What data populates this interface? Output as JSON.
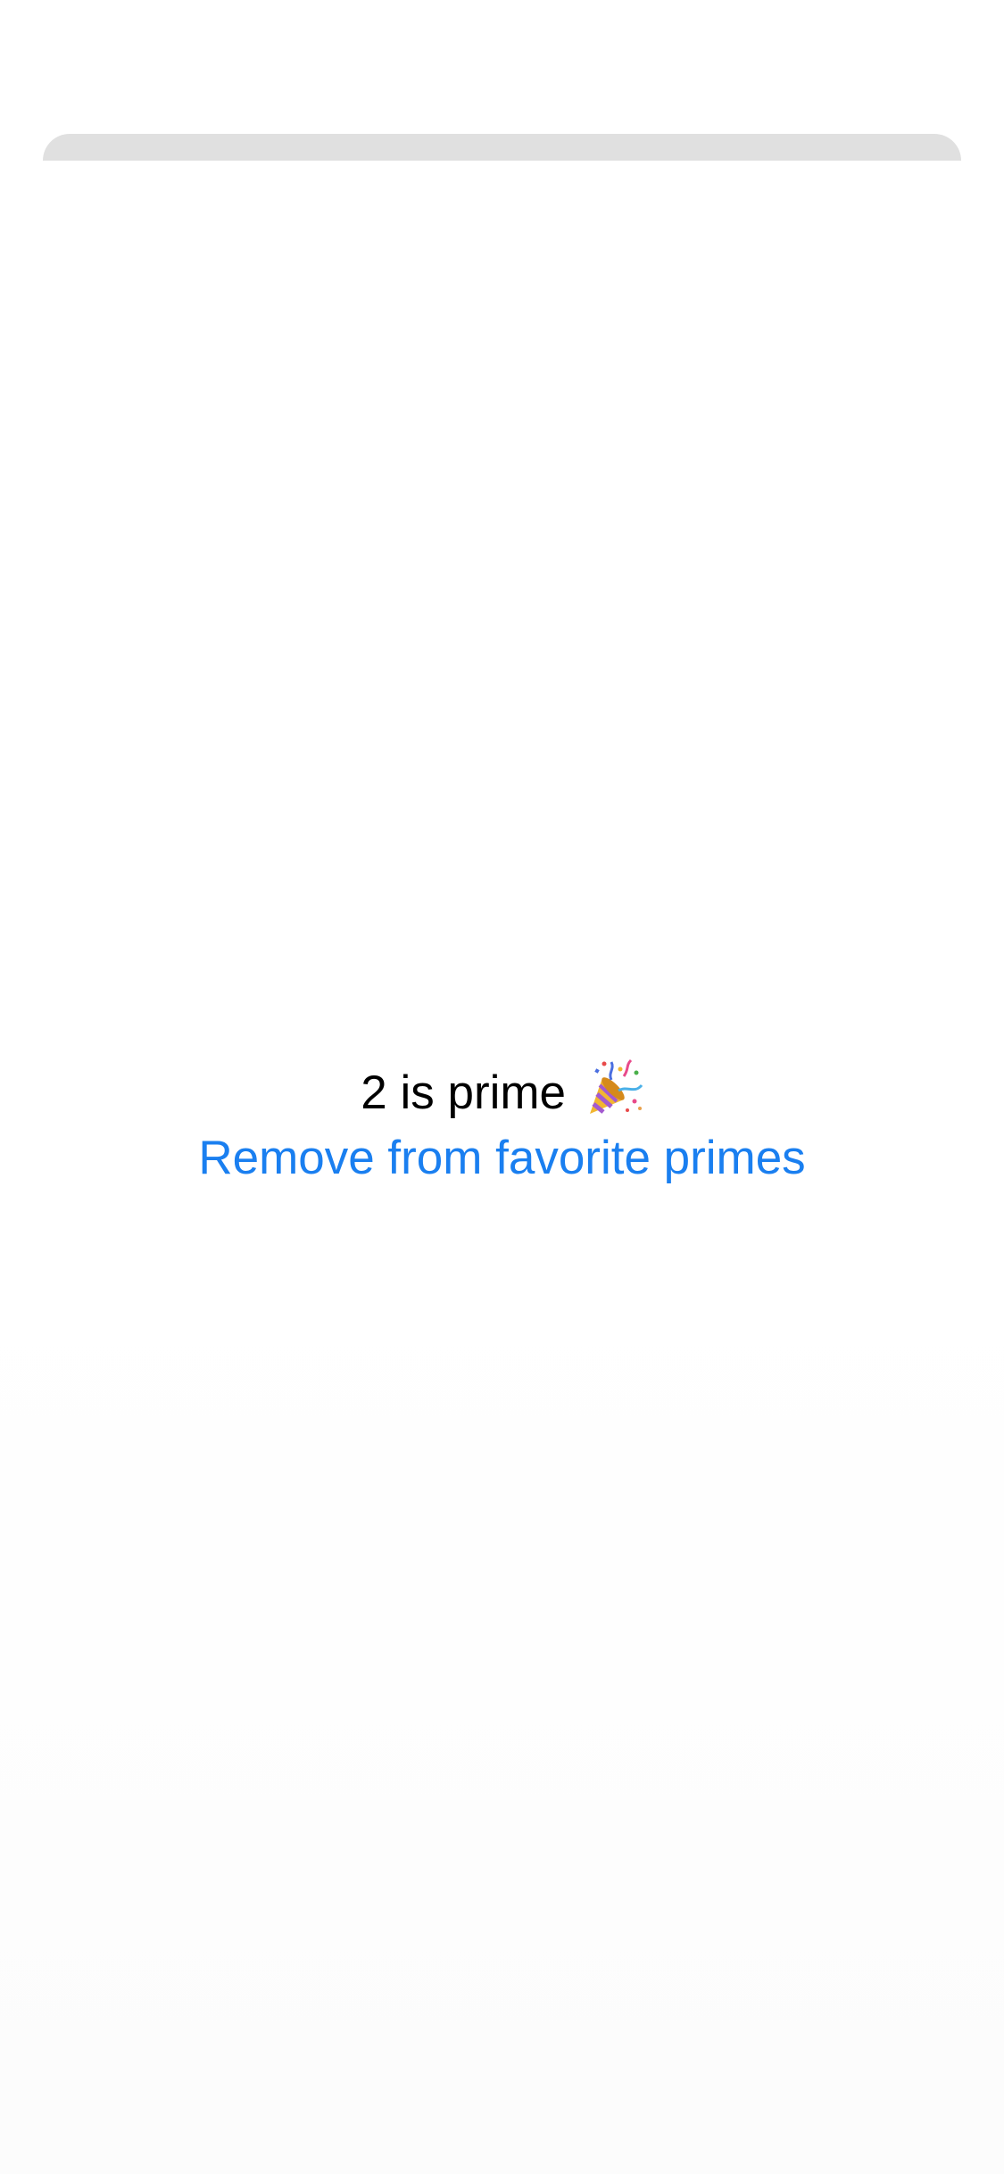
{
  "prime": {
    "message": "2 is prime",
    "icon": "party-popper-icon"
  },
  "actions": {
    "remove_label": "Remove from favorite primes"
  },
  "colors": {
    "link": "#1a7ff0",
    "text": "#000000",
    "sheet_peek": "#e0e0e0"
  }
}
